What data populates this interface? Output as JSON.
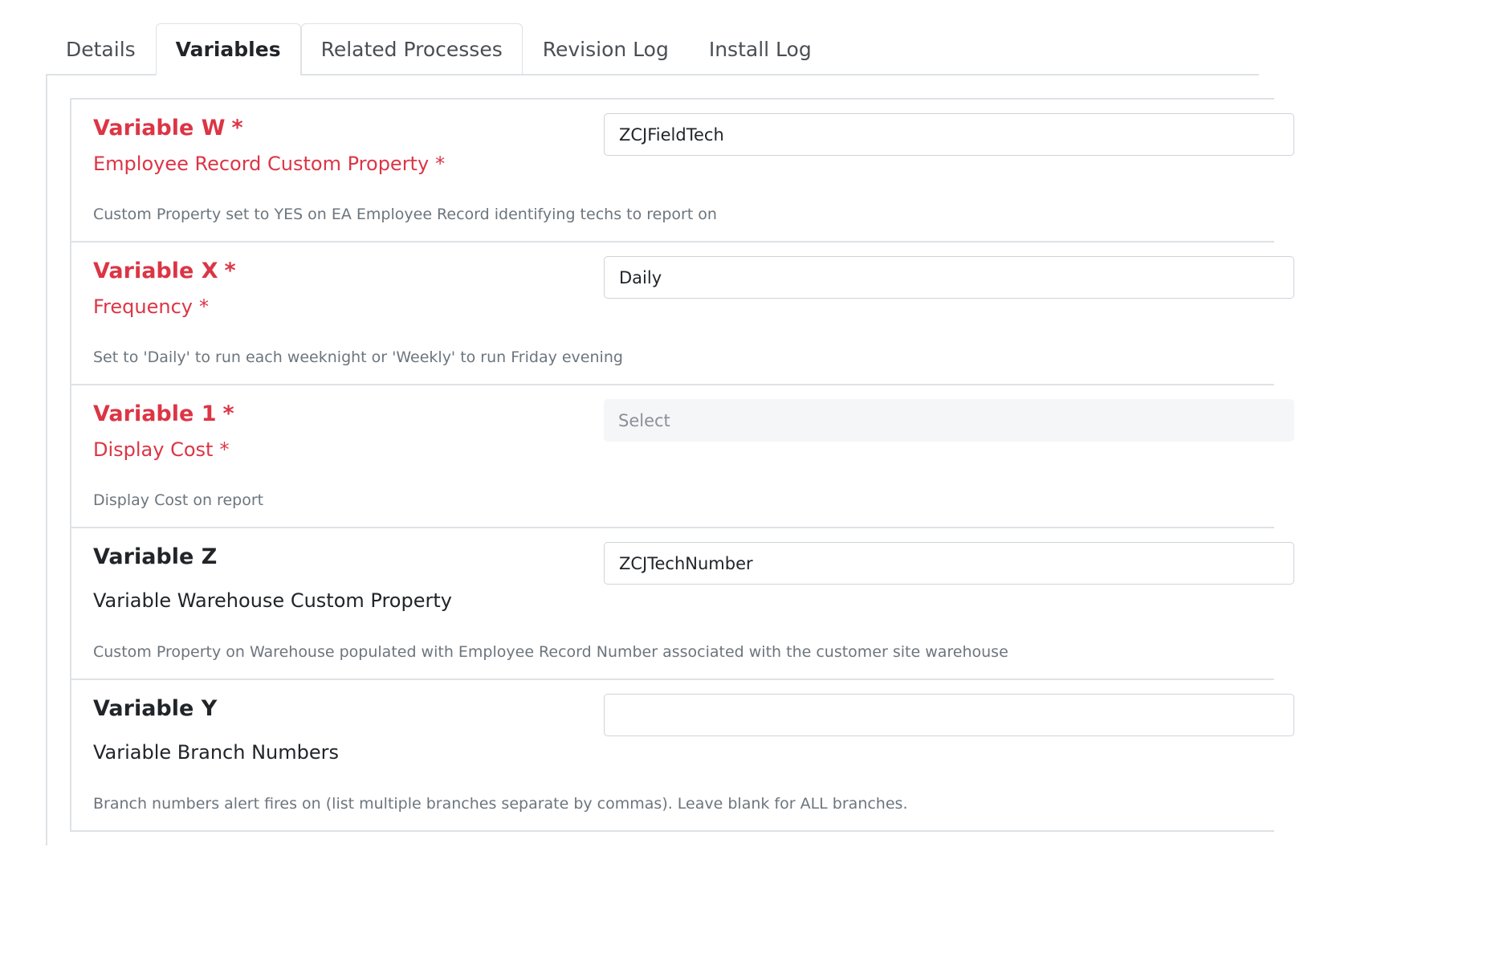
{
  "tabs": [
    {
      "label": "Details"
    },
    {
      "label": "Variables"
    },
    {
      "label": "Related Processes"
    },
    {
      "label": "Revision Log"
    },
    {
      "label": "Install Log"
    }
  ],
  "variables": [
    {
      "title": "Variable W",
      "subtitle": "Employee Record Custom Property",
      "help": "Custom Property set to YES on EA Employee Record identifying techs to report on",
      "value": "ZCJFieldTech",
      "required_marker": "*"
    },
    {
      "title": "Variable X",
      "subtitle": "Frequency",
      "help": "Set to 'Daily' to run each weeknight or 'Weekly' to run Friday evening",
      "value": "Daily",
      "required_marker": "*"
    },
    {
      "title": "Variable 1",
      "subtitle": "Display Cost",
      "help": "Display Cost on report",
      "placeholder": "Select",
      "required_marker": "*"
    },
    {
      "title": "Variable Z",
      "subtitle": "Variable Warehouse Custom Property",
      "help": "Custom Property on Warehouse populated with Employee Record Number associated with the customer site warehouse",
      "value": "ZCJTechNumber"
    },
    {
      "title": "Variable Y",
      "subtitle": "Variable Branch Numbers",
      "help": "Branch numbers alert fires on (list multiple branches separate by commas). Leave blank for ALL branches.",
      "value": ""
    }
  ],
  "colors": {
    "required": "#dc3545",
    "border": "#dee2e6",
    "help_text": "#6c757d"
  }
}
